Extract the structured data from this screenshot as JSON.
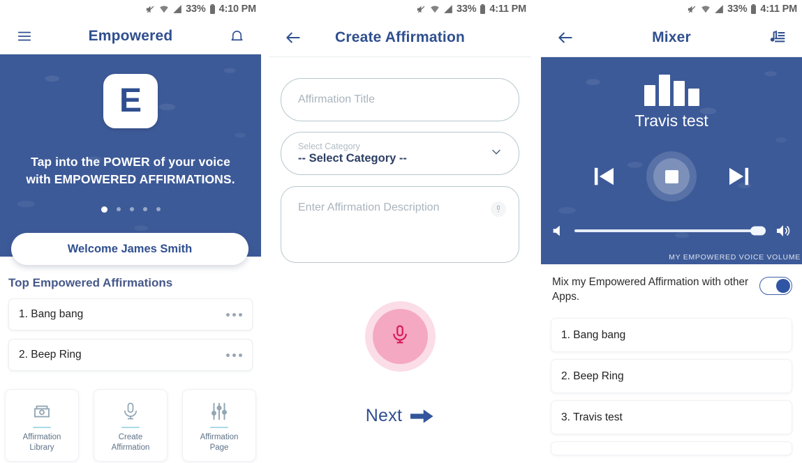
{
  "screens": [
    {
      "status": {
        "time": "4:10 PM",
        "battery": "33%",
        "icons": [
          "mute-icon",
          "wifi-icon",
          "signal-icon",
          "battery-icon"
        ]
      },
      "appbar": {
        "title": "Empowered",
        "left_icon": "hamburger-menu-icon",
        "right_icon": "notification-bell-icon"
      },
      "hero": {
        "logo_letter": "E",
        "tagline_line1": "Tap into the POWER of your voice",
        "tagline_line2": "with EMPOWERED AFFIRMATIONS.",
        "dots_total": 5,
        "dots_active_index": 0
      },
      "welcome": "Welcome James Smith",
      "section_title": "Top Empowered Affirmations",
      "affirmations": [
        {
          "label": "1. Bang bang",
          "menu": "kebab-menu-icon"
        },
        {
          "label": "2. Beep Ring",
          "menu": "kebab-menu-icon"
        }
      ],
      "quicknav": [
        {
          "icon": "library-icon",
          "line1": "Affirmation",
          "line2": "Library"
        },
        {
          "icon": "microphone-icon",
          "line1": "Create",
          "line2": "Affirmation"
        },
        {
          "icon": "sliders-icon",
          "line1": "Affirmation",
          "line2": "Page"
        }
      ]
    },
    {
      "status": {
        "time": "4:11 PM",
        "battery": "33%"
      },
      "appbar": {
        "title": "Create Affirmation",
        "left_icon": "back-arrow-icon"
      },
      "form": {
        "title_placeholder": "Affirmation Title",
        "title_value": "",
        "category_label": "Select Category",
        "category_value": "-- Select Category --",
        "category_chevron": "chevron-down-icon",
        "description_placeholder": "Enter Affirmation Description",
        "description_value": "",
        "description_mic_icon": "microphone-icon"
      },
      "record_button": {
        "icon": "microphone-icon"
      },
      "next": {
        "label": "Next",
        "icon": "arrow-right-icon"
      }
    },
    {
      "status": {
        "time": "4:11 PM",
        "battery": "33%"
      },
      "appbar": {
        "title": "Mixer",
        "left_icon": "back-arrow-icon",
        "right_icon": "playlist-music-icon"
      },
      "player": {
        "artwork_icon": "equalizer-bars-icon",
        "track_title": "Travis test",
        "prev_icon": "skip-previous-icon",
        "stop_icon": "stop-icon",
        "next_icon": "skip-next-icon",
        "volume_low_icon": "volume-low-icon",
        "volume_high_icon": "volume-high-icon",
        "volume_percent": 96,
        "volume_caption": "MY EMPOWERED VOICE VOLUME"
      },
      "mix_toggle": {
        "label": "Mix my Empowered Affirmation with other Apps.",
        "on": true
      },
      "tracks": [
        {
          "label": "1. Bang bang"
        },
        {
          "label": "2. Beep Ring"
        },
        {
          "label": "3. Travis test"
        }
      ]
    }
  ],
  "colors": {
    "brand_blue": "#3d5a98",
    "title_blue": "#2f4f8f",
    "record_pink": "#f5a8c1",
    "record_halo": "#fbdde7",
    "mic_crimson": "#d81b60"
  }
}
